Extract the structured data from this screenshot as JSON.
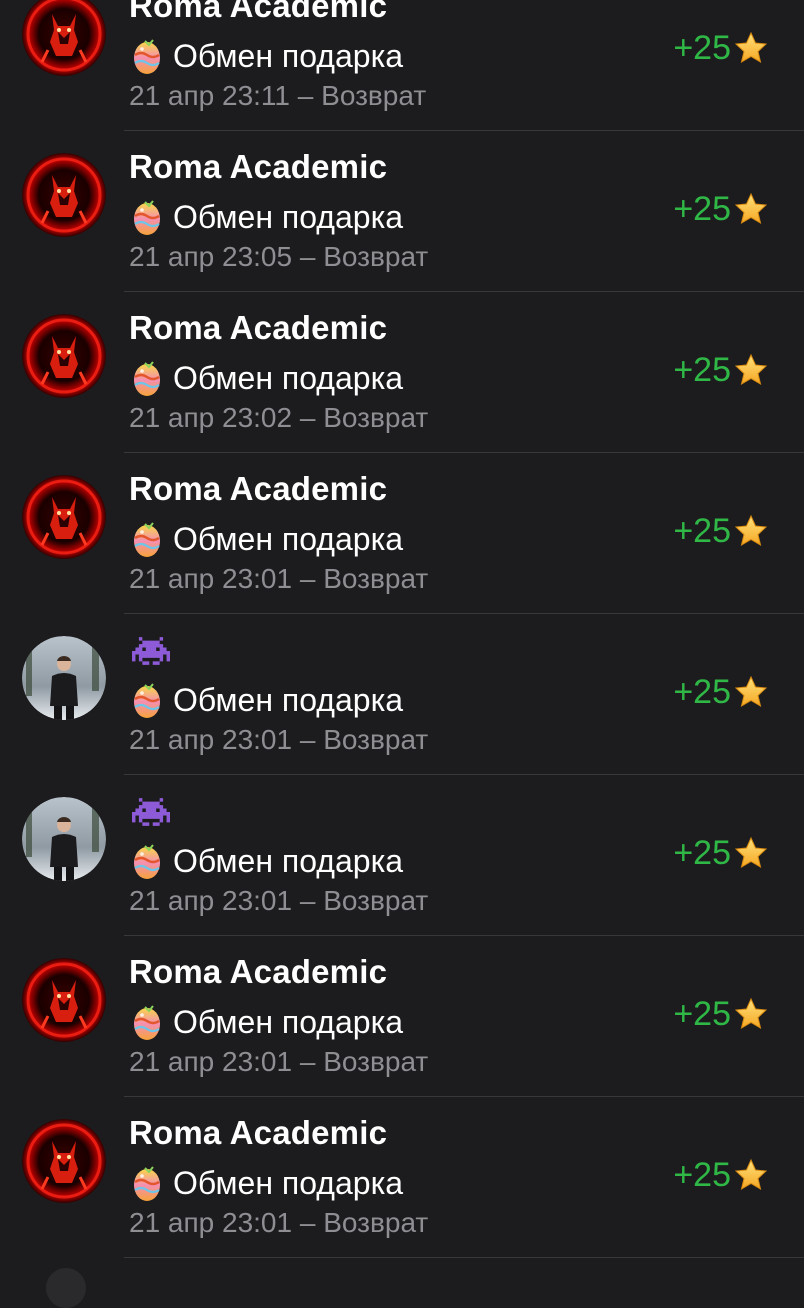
{
  "transactions": [
    {
      "name": "Roma Academic",
      "avatar": "red-fox-avatar",
      "title": "Обмен подарка",
      "time": "21 апр 23:11",
      "separator": " – ",
      "type": "Возврат",
      "amount": "+25"
    },
    {
      "name": "Roma Academic",
      "avatar": "red-fox-avatar",
      "title": "Обмен подарка",
      "time": "21 апр 23:05",
      "separator": " – ",
      "type": "Возврат",
      "amount": "+25"
    },
    {
      "name": "Roma Academic",
      "avatar": "red-fox-avatar",
      "title": "Обмен подарка",
      "time": "21 апр 23:02",
      "separator": " – ",
      "type": "Возврат",
      "amount": "+25"
    },
    {
      "name": "Roma Academic",
      "avatar": "red-fox-avatar",
      "title": "Обмен подарка",
      "time": "21 апр 23:01",
      "separator": " – ",
      "type": "Возврат",
      "amount": "+25"
    },
    {
      "name": "",
      "name_icon": "space-invader-icon",
      "avatar": "person-photo-avatar",
      "title": "Обмен подарка",
      "time": "21 апр 23:01",
      "separator": " – ",
      "type": "Возврат",
      "amount": "+25"
    },
    {
      "name": "",
      "name_icon": "space-invader-icon",
      "avatar": "person-photo-avatar",
      "title": "Обмен подарка",
      "time": "21 апр 23:01",
      "separator": " – ",
      "type": "Возврат",
      "amount": "+25"
    },
    {
      "name": "Roma Academic",
      "avatar": "red-fox-avatar",
      "title": "Обмен подарка",
      "time": "21 апр 23:01",
      "separator": " – ",
      "type": "Возврат",
      "amount": "+25"
    },
    {
      "name": "Roma Academic",
      "avatar": "red-fox-avatar",
      "title": "Обмен подарка",
      "time": "21 апр 23:01",
      "separator": " – ",
      "type": "Возврат",
      "amount": "+25"
    }
  ],
  "colors": {
    "background": "#1c1c1e",
    "amount_positive": "#30b847",
    "secondary_text": "#8e8e93",
    "divider": "#38383a"
  }
}
